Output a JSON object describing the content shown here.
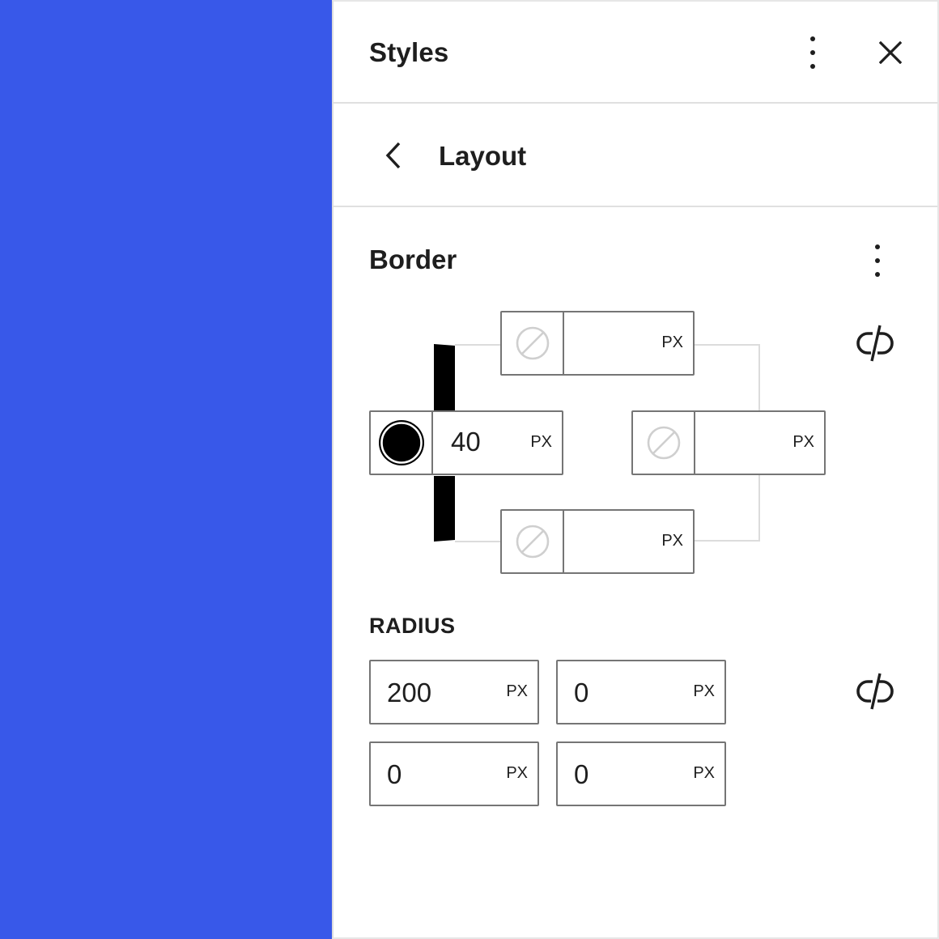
{
  "header": {
    "title": "Styles",
    "more_icon": "more-vertical-icon",
    "close_icon": "close-icon"
  },
  "nav": {
    "back_icon": "chevron-left-icon",
    "title": "Layout"
  },
  "border": {
    "title": "Border",
    "more_icon": "more-vertical-icon",
    "link_icon": "unlink-icon",
    "sides": {
      "top": {
        "value": "",
        "unit": "PX",
        "color": "none"
      },
      "left": {
        "value": "40",
        "unit": "PX",
        "color": "#000000"
      },
      "right": {
        "value": "",
        "unit": "PX",
        "color": "none"
      },
      "bottom": {
        "value": "",
        "unit": "PX",
        "color": "none"
      }
    }
  },
  "radius": {
    "label": "RADIUS",
    "link_icon": "unlink-icon",
    "top_left": {
      "value": "200",
      "unit": "PX"
    },
    "top_right": {
      "value": "0",
      "unit": "PX"
    },
    "bottom_left": {
      "value": "0",
      "unit": "PX"
    },
    "bottom_right": {
      "value": "0",
      "unit": "PX"
    }
  },
  "colors": {
    "canvas": "#3858e9",
    "accent_border": "#000000",
    "field_border": "#757575"
  }
}
